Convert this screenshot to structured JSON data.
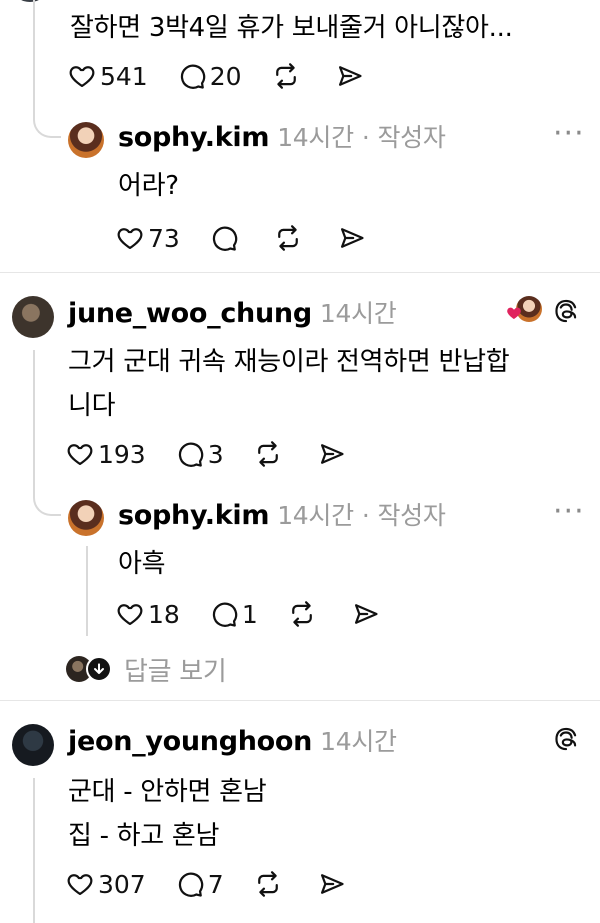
{
  "post_top": {
    "text": "잘하면 3박4일 휴가 보내줄거 아니잖아...",
    "likes": "541",
    "replies": "20"
  },
  "reply1": {
    "username": "sophy.kim",
    "time": "14시간",
    "sep": "·",
    "author_tag": "작성자",
    "text": "어라?",
    "likes": "73",
    "more": "···"
  },
  "comment2": {
    "username": "june_woo_chung",
    "time": "14시간",
    "text_line1": "그거 군대 귀속 재능이라 전역하면 반납합",
    "text_line2": "니다",
    "likes": "193",
    "replies": "3"
  },
  "reply2": {
    "username": "sophy.kim",
    "time": "14시간",
    "sep": "·",
    "author_tag": "작성자",
    "text": "아흑",
    "likes": "18",
    "replies": "1",
    "more": "···"
  },
  "view_replies": {
    "label": "답글 보기"
  },
  "comment3": {
    "username": "jeon_younghoon",
    "time": "14시간",
    "text_line1": "군대 - 안하면 혼남",
    "text_line2": "집 - 하고 혼남",
    "likes": "307",
    "replies": "7"
  },
  "colors": {
    "meta_gray": "#9b9b9b",
    "like_heart_red": "#e0245e",
    "divider": "#e6e6e6"
  }
}
